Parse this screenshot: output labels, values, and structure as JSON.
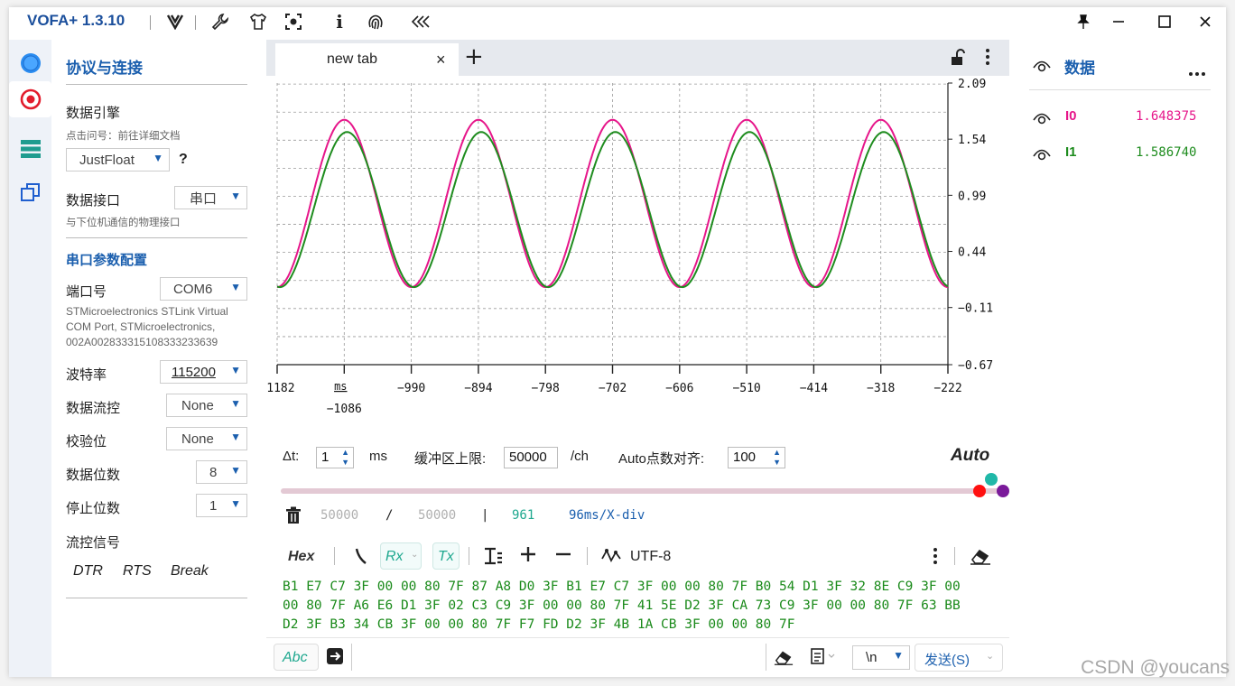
{
  "app": {
    "title": "VOFA+ 1.3.10"
  },
  "left_panel": {
    "title": "协议与连接",
    "engine_label": "数据引擎",
    "engine_hint": "点击问号：前往详细文档",
    "engine_value": "JustFloat",
    "help": "?",
    "interface_label": "数据接口",
    "interface_value": "串口",
    "interface_hint": "与下位机通信的物理接口",
    "serial_title": "串口参数配置",
    "port_label": "端口号",
    "port_value": "COM6",
    "port_desc_1": "STMicroelectronics STLink Virtual",
    "port_desc_2": "COM Port, STMicroelectronics,",
    "port_desc_3": "002A002833315108333233639",
    "baud_label": "波特率",
    "baud_value": "115200",
    "flow_label": "数据流控",
    "flow_value": "None",
    "parity_label": "校验位",
    "parity_value": "None",
    "databits_label": "数据位数",
    "databits_value": "8",
    "stopbits_label": "停止位数",
    "stopbits_value": "1",
    "signal_label": "流控信号",
    "dtr": "DTR",
    "rts": "RTS",
    "brk": "Break"
  },
  "tab": {
    "label": "new tab",
    "close": "×",
    "add": "+"
  },
  "chart_data": {
    "type": "line",
    "y_ticks": [
      "2.09",
      "1.54",
      "0.99",
      "0.44",
      "−0.11",
      "−0.67"
    ],
    "ylim": [
      -0.67,
      2.09
    ],
    "x_ticks": [
      "−1182",
      "−1086",
      "−990",
      "−894",
      "−798",
      "−702",
      "−606",
      "−510",
      "−414",
      "−318",
      "−222"
    ],
    "x_unit": "ms",
    "xlim": [
      -1182,
      -222
    ],
    "series": [
      {
        "name": "I0",
        "color": "#e6168a",
        "amplitude": 0.82,
        "offset": 0.91,
        "period": 192,
        "phase_x": -1086
      },
      {
        "name": "I1",
        "color": "#1e8c1e",
        "amplitude": 0.76,
        "offset": 0.85,
        "period": 192,
        "phase_x": -1082
      }
    ],
    "grid": true
  },
  "controls": {
    "dt_label": "Δt:",
    "dt_value": "1",
    "dt_unit": "ms",
    "buffer_label": "缓冲区上限:",
    "buffer_value": "50000",
    "buffer_unit": "/ch",
    "auto_align_label": "Auto点数对齐:",
    "auto_align_value": "100",
    "auto_label": "Auto",
    "count_a": "50000",
    "slash": "/",
    "count_b": "50000",
    "bar": "|",
    "count_c": "961",
    "xdiv": "96ms/X-div"
  },
  "terminal": {
    "hex": "Hex",
    "rx": "Rx",
    "tx": "Tx",
    "encoding": "UTF-8",
    "line1": "B1 E7 C7 3F 00 00 80 7F 87 A8 D0 3F B1 E7 C7 3F 00 00 80 7F B0 54 D1 3F 32 8E C9 3F 00",
    "line2": "00 80 7F A6 E6 D1 3F 02 C3 C9 3F 00 00 80 7F 41 5E D2 3F CA 73 C9 3F 00 00 80 7F 63 BB",
    "line3": "D2 3F B3 34 CB 3F 00 00 80 7F F7 FD D2 3F 4B 1A CB 3F 00 00 80 7F"
  },
  "send": {
    "abc": "Abc",
    "newline": "\\n",
    "send_label": "发送(S)"
  },
  "data_panel": {
    "title": "数据",
    "channels": [
      {
        "name": "I0",
        "value": "1.648375",
        "color": "#e6168a"
      },
      {
        "name": "I1",
        "value": "1.586740",
        "color": "#1e8c1e"
      }
    ]
  },
  "watermark": "CSDN @youcans"
}
